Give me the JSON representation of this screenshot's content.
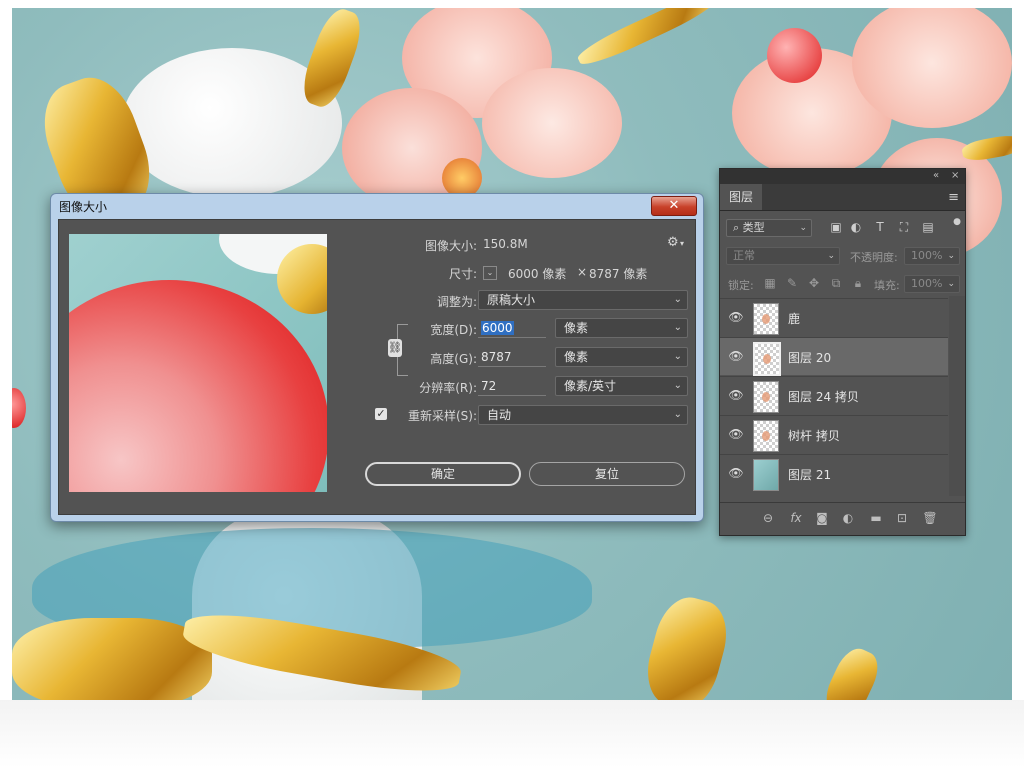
{
  "dialog": {
    "title": "图像大小",
    "close_glyph": "✕",
    "image_size_label": "图像大小:",
    "image_size_value": "150.8M",
    "dimensions_label": "尺寸:",
    "dimensions_width": "6000 像素",
    "dimensions_times": "×",
    "dimensions_height": "8787 像素",
    "fit_to_label": "调整为:",
    "fit_to_value": "原稿大小",
    "width_label": "宽度(D):",
    "width_value": "6000",
    "width_unit": "像素",
    "height_label": "高度(G):",
    "height_value": "8787",
    "height_unit": "像素",
    "resolution_label": "分辨率(R):",
    "resolution_value": "72",
    "resolution_unit": "像素/英寸",
    "resample_label": "重新采样(S):",
    "resample_checked": true,
    "resample_value": "自动",
    "ok_label": "确定",
    "reset_label": "复位"
  },
  "layers_panel": {
    "collapse_glyph": "«",
    "close_glyph": "×",
    "tab_label": "图层",
    "filter_kind": "类型",
    "blend_mode": "正常",
    "opacity_label": "不透明度:",
    "opacity_value": "100%",
    "lock_label": "锁定:",
    "fill_label": "填充:",
    "fill_value": "100%",
    "layers": [
      {
        "name": "鹿",
        "visible": true,
        "active": false
      },
      {
        "name": "图层 20",
        "visible": true,
        "active": true
      },
      {
        "name": "图层 24 拷贝",
        "visible": true,
        "active": false
      },
      {
        "name": "树杆 拷贝",
        "visible": true,
        "active": false
      },
      {
        "name": "图层 21",
        "visible": true,
        "active": false
      }
    ],
    "footer_fx": "fx"
  },
  "colors": {
    "accent_selection": "#2f6fc2",
    "panel_bg": "#535353",
    "dialog_frame": "#b9d1ea",
    "close_button": "#c8412a"
  }
}
